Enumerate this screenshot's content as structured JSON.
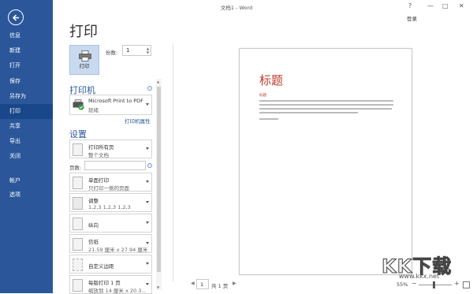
{
  "window": {
    "title": "文档1 - Word",
    "help": "?",
    "minimize": "—",
    "restore": "□",
    "close": "✕",
    "login": "登录"
  },
  "nav": {
    "items": [
      {
        "label": "信息"
      },
      {
        "label": "新建"
      },
      {
        "label": "打开"
      },
      {
        "label": "保存"
      },
      {
        "label": "另存为"
      },
      {
        "label": "打印"
      },
      {
        "label": "共享"
      },
      {
        "label": "导出"
      },
      {
        "label": "关闭"
      },
      {
        "label": "帐户"
      },
      {
        "label": "选项"
      }
    ],
    "active": "打印",
    "accent": "#2b579a"
  },
  "print": {
    "heading": "打印",
    "button_label": "打印",
    "copies_label": "份数:",
    "copies_value": "1"
  },
  "printer": {
    "section_title": "打印机",
    "name": "Microsoft Print to PDF",
    "status": "就绪",
    "properties_link": "打印机属性"
  },
  "settings": {
    "section_title": "设置",
    "pages_label": "页数:",
    "pages_value": "",
    "options": [
      {
        "line1": "打印所有页",
        "line2": "整个文档"
      },
      {
        "line1": "单面打印",
        "line2": "只打印一侧的页面"
      },
      {
        "line1": "调整",
        "line2": "1,2,3    1,2,3    1,2,3"
      },
      {
        "line1": "纵向",
        "line2": ""
      },
      {
        "line1": "信纸",
        "line2": "21.59 厘米 x 27.94 厘米"
      },
      {
        "line1": "自定义边距",
        "line2": ""
      },
      {
        "line1": "每版打印 1 页",
        "line2": "缩放到 14 厘米 x 20.3..."
      }
    ]
  },
  "preview": {
    "doc_title": "标题",
    "doc_heading": "标题",
    "title_color": "#c0392b"
  },
  "pager": {
    "current": "1",
    "total": "共 1 页",
    "prev": "◀",
    "next": "▶"
  },
  "zoom": {
    "level": "55%",
    "minus": "−",
    "plus": "+"
  },
  "watermark": {
    "text": "KK下载",
    "url": "www.kkx.net"
  }
}
